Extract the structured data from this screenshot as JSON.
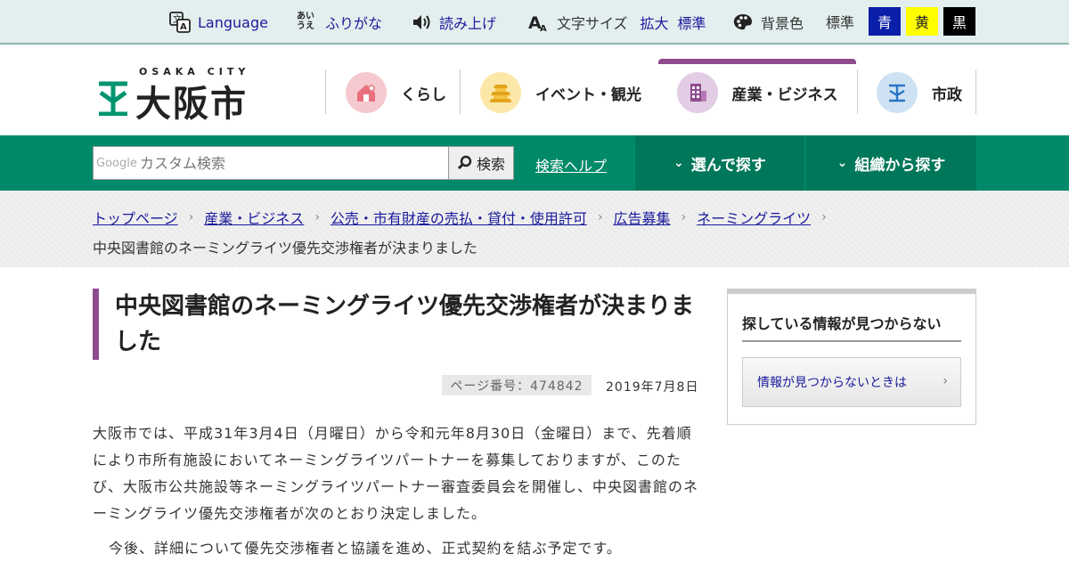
{
  "utility": {
    "language": "Language",
    "furigana": "ふりがな",
    "read_aloud": "読み上げ",
    "text_size_label": "文字サイズ",
    "enlarge": "拡大",
    "standard_size": "標準",
    "bg_color_label": "背景色",
    "bg_standard": "標準",
    "bg_blue": "青",
    "bg_yellow": "黄",
    "bg_black": "黒",
    "furigana_icon_text": "あい\nうえ"
  },
  "logo": {
    "sub": "OSAKA CITY",
    "main": "大阪市"
  },
  "nav": [
    {
      "label": "くらし",
      "icon": "house-icon"
    },
    {
      "label": "イベント・観光",
      "icon": "castle-icon"
    },
    {
      "label": "産業・ビジネス",
      "icon": "building-icon",
      "active": true
    },
    {
      "label": "市政",
      "icon": "city-emblem-icon"
    }
  ],
  "search": {
    "google_label": "Google",
    "placeholder": "カスタム検索",
    "button": "検索",
    "help": "検索ヘルプ",
    "choose": "選んで探す",
    "org": "組織から探す"
  },
  "breadcrumb": {
    "items": [
      "トップページ",
      "産業・ビジネス",
      "公売・市有財産の売払・貸付・使用許可",
      "広告募集",
      "ネーミングライツ"
    ],
    "current": "中央図書館のネーミングライツ優先交渉権者が決まりました"
  },
  "article": {
    "title": "中央図書館のネーミングライツ優先交渉権者が決まりました",
    "page_number": "ページ番号：474842",
    "date": "2019年7月8日",
    "paragraph1": "大阪市では、平成31年3月4日（月曜日）から令和元年8月30日（金曜日）まで、先着順により市所有施設においてネーミングライツパートナーを募集しておりますが、このたび、大阪市公共施設等ネーミングライツパートナー審査委員会を開催し、中央図書館のネーミングライツ優先交渉権者が次のとおり決定しました。",
    "paragraph2": "今後、詳細について優先交渉権者と協議を進め、正式契約を結ぶ予定です。"
  },
  "sidebar": {
    "heading": "探している情報が見つからない",
    "link": "情報が見つからないときは"
  },
  "colors": {
    "brand_green": "#008a69",
    "accent_purple": "#8e4c8f",
    "link_blue": "#1a1a9c"
  }
}
